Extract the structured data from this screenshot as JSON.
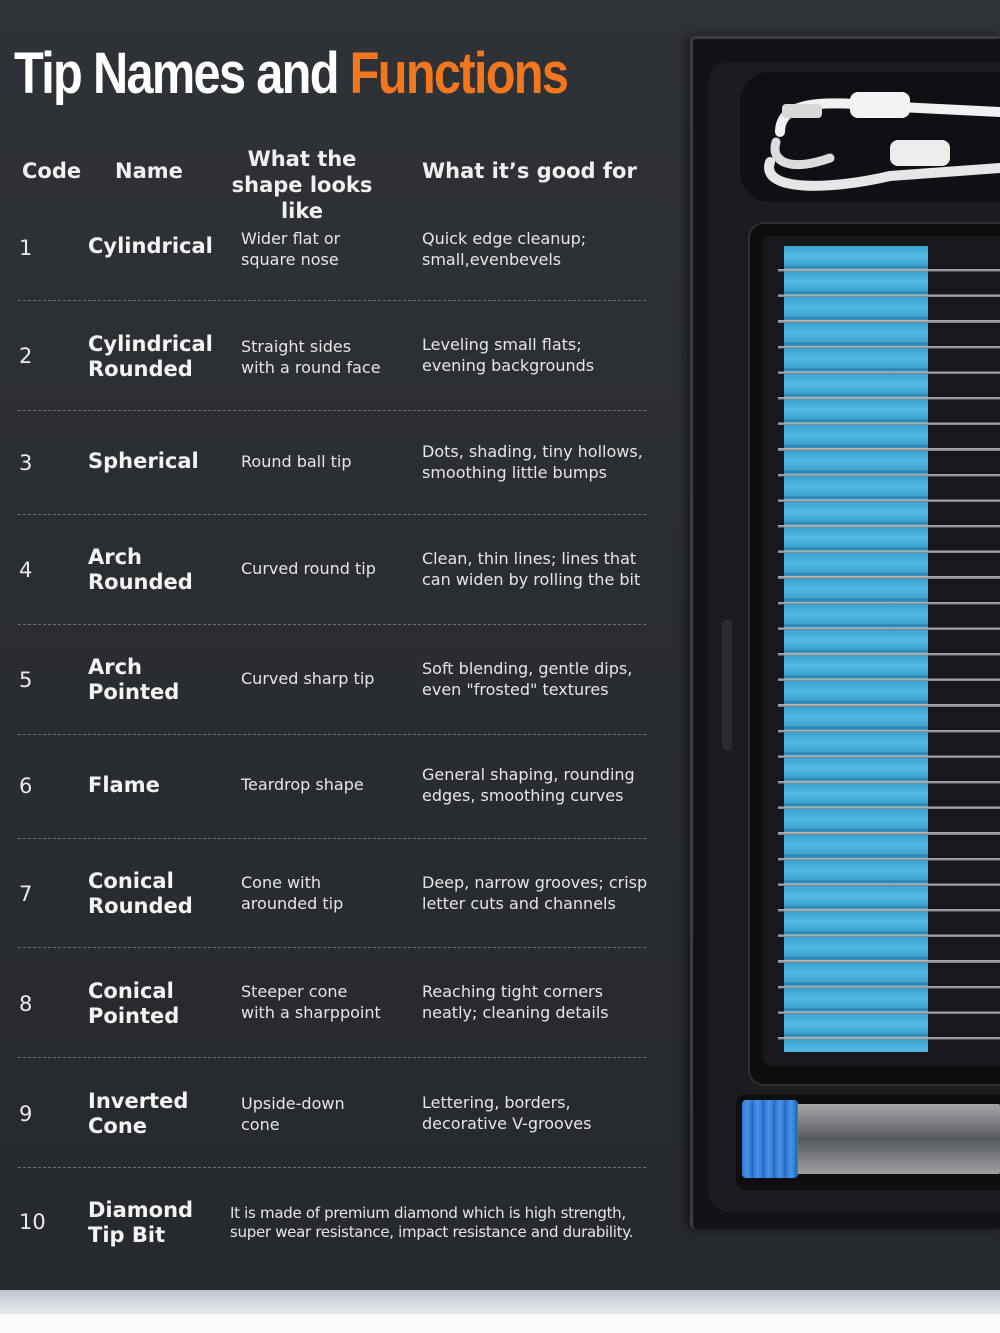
{
  "title": {
    "part1": "Tip Names and ",
    "part2": "Functions"
  },
  "headers": {
    "code": "Code",
    "name": "Name",
    "shape": "What the shape looks like",
    "good": "What it’s good for"
  },
  "rows": [
    {
      "code": "1",
      "name": "Cylindrical",
      "shape": "Wider flat or\nsquare nose",
      "good": "Quick edge cleanup;\nsmall,evenbevels"
    },
    {
      "code": "2",
      "name": "Cylindrical\nRounded",
      "shape": "Straight sides\nwith a round face",
      "good": "Leveling small flats;\nevening backgrounds"
    },
    {
      "code": "3",
      "name": "Spherical",
      "shape": "Round ball tip",
      "good": "Dots, shading, tiny hollows,\nsmoothing little bumps"
    },
    {
      "code": "4",
      "name": "Arch\nRounded",
      "shape": "Curved round tip",
      "good": "Clean, thin lines; lines that\ncan widen by rolling the bit"
    },
    {
      "code": "5",
      "name": "Arch\nPointed",
      "shape": "Curved sharp tip",
      "good": "Soft blending, gentle dips,\neven \"frosted\" textures"
    },
    {
      "code": "6",
      "name": "Flame",
      "shape": "Teardrop shape",
      "good": "General shaping, rounding\nedges, smoothing curves"
    },
    {
      "code": "7",
      "name": "Conical\nRounded",
      "shape": "Cone with\narounded tip",
      "good": "Deep, narrow grooves; crisp\nletter cuts and channels"
    },
    {
      "code": "8",
      "name": "Conical\nPointed",
      "shape": "Steeper cone\nwith a sharppoint",
      "good": "Reaching tight corners\nneatly; cleaning details"
    },
    {
      "code": "9",
      "name": "Inverted\nCone",
      "shape": "Upside-down\ncone",
      "good": "Lettering, borders,\ndecorative V-grooves"
    },
    {
      "code": "10",
      "name": "Diamond\nTip Bit",
      "description": "It is made of premium diamond which is high strength,\nsuper wear resistance, impact resistance and durability."
    }
  ],
  "colors": {
    "accent": "#f3771f",
    "background": "#2b2e33",
    "foam": "#3aa3d2",
    "cap": "#2f79d6"
  },
  "product_image": {
    "icon": "drill-bit-kit-box-photo"
  }
}
